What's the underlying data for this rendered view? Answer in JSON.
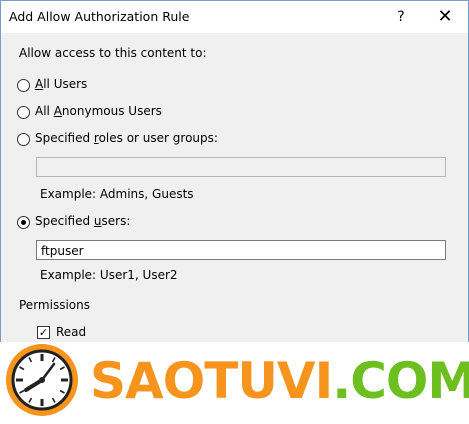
{
  "dialog": {
    "title": "Add Allow Authorization Rule",
    "help_glyph": "?",
    "close_glyph": "✕"
  },
  "access": {
    "heading": "Allow access to this content to:",
    "options": [
      {
        "prefix": "",
        "ul": "A",
        "suffix": "ll Users",
        "selected": false
      },
      {
        "prefix": "All ",
        "ul": "A",
        "suffix": "nonymous Users",
        "selected": false
      },
      {
        "prefix": "Specified ",
        "ul": "r",
        "suffix": "oles or user groups:",
        "selected": false
      },
      {
        "prefix": "Specified ",
        "ul": "u",
        "suffix": "sers:",
        "selected": true
      }
    ],
    "roles_value": "",
    "roles_example": "Example: Admins, Guests",
    "users_value": "ftpuser",
    "users_example": "Example: User1, User2"
  },
  "permissions": {
    "heading": "Permissions",
    "read_label": "Read",
    "read_checked": true
  },
  "watermark": {
    "part1": "SAOTUVI",
    "part2": ".COM",
    "color1": "#f7941d",
    "color2": "#6cbf1f"
  }
}
